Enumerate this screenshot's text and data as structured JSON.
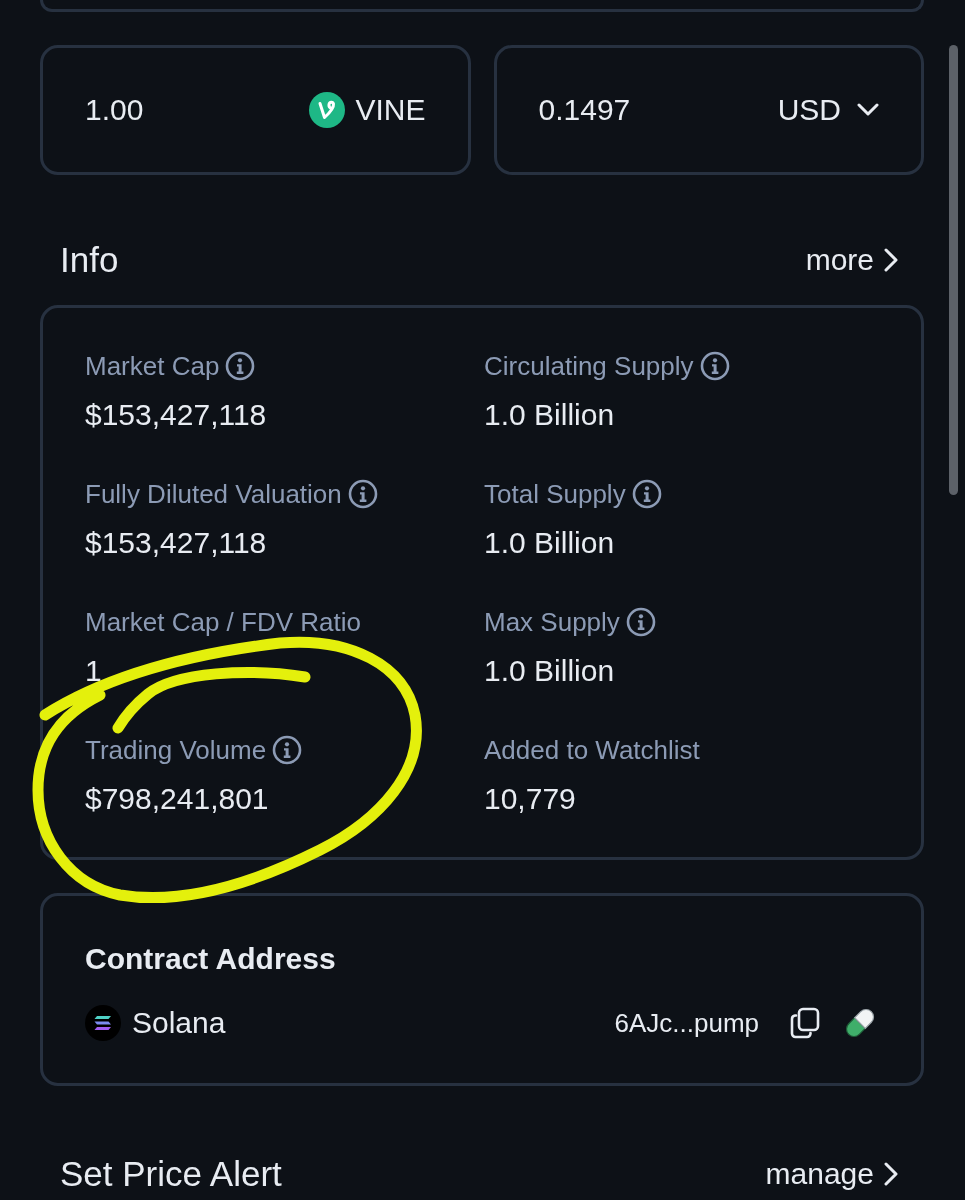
{
  "converter": {
    "from": {
      "value": "1.00",
      "token": "VINE"
    },
    "to": {
      "value": "0.1497",
      "currency": "USD"
    }
  },
  "info": {
    "title": "Info",
    "more": "more",
    "stats": [
      {
        "label": "Market Cap",
        "value": "$153,427,118",
        "info_icon": true
      },
      {
        "label": "Circulating Supply",
        "value": "1.0 Billion",
        "info_icon": true
      },
      {
        "label": "Fully Diluted Valuation",
        "value": "$153,427,118",
        "info_icon": true
      },
      {
        "label": "Total Supply",
        "value": "1.0 Billion",
        "info_icon": true
      },
      {
        "label": "Market Cap / FDV Ratio",
        "value": "1",
        "info_icon": false
      },
      {
        "label": "Max Supply",
        "value": "1.0 Billion",
        "info_icon": true
      },
      {
        "label": "Trading Volume",
        "value": "$798,241,801",
        "info_icon": true
      },
      {
        "label": "Added to Watchlist",
        "value": "10,779",
        "info_icon": false
      }
    ]
  },
  "contract": {
    "title": "Contract Address",
    "chain": "Solana",
    "address": "6AJc...pump"
  },
  "price_alert": {
    "title": "Set Price Alert",
    "link": "manage"
  }
}
